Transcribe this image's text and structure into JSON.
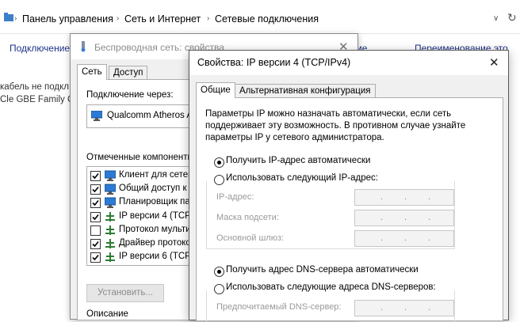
{
  "breadcrumb": {
    "items": [
      "Панель управления",
      "Сеть и Интернет",
      "Сетевые подключения"
    ]
  },
  "toolbar": {
    "left_label": "Подключение",
    "middle_label": "ие",
    "right_label": "Переименование это"
  },
  "explorer_side": {
    "line1": "кабель не подкл",
    "line2": "Cle GBE Family C"
  },
  "wireless_dialog": {
    "title": "Беспроводная сеть: свойства",
    "tabs": [
      "Сеть",
      "Доступ"
    ],
    "connect_via_label": "Подключение через:",
    "adapter_name": "Qualcomm Atheros A",
    "components_label": "Отмеченные компоненты",
    "components": [
      {
        "label": "Клиент для сетей",
        "checked": true,
        "icon": "network-client-icon"
      },
      {
        "label": "Общий доступ к ф",
        "checked": true,
        "icon": "file-sharing-icon"
      },
      {
        "label": "Планировщик па",
        "checked": true,
        "icon": "packet-scheduler-icon"
      },
      {
        "label": "IP версии 4 (TCP",
        "checked": true,
        "icon": "protocol-icon"
      },
      {
        "label": "Протокол мульти",
        "checked": false,
        "icon": "protocol-icon"
      },
      {
        "label": "Драйвер протоко",
        "checked": true,
        "icon": "protocol-icon"
      },
      {
        "label": "IP версии 6 (TCP",
        "checked": true,
        "icon": "protocol-icon"
      }
    ],
    "install_button": "Установить...",
    "description_label": "Описание"
  },
  "ipv4_dialog": {
    "title": "Свойства: IP версии 4 (TCP/IPv4)",
    "tabs": [
      "Общие",
      "Альтернативная конфигурация"
    ],
    "description": [
      "Параметры IP можно назначать автоматически, если сеть",
      "поддерживает эту возможность. В противном случае узнайте",
      "параметры IP у сетевого администратора."
    ],
    "ip_auto_label": "Получить IP-адрес автоматически",
    "ip_manual_label": "Использовать следующий IP-адрес:",
    "ip_mode": "auto",
    "ip_fields": [
      {
        "label": "IP-адрес:"
      },
      {
        "label": "Маска подсети:"
      },
      {
        "label": "Основной шлюз:"
      }
    ],
    "dns_auto_label": "Получить адрес DNS-сервера автоматически",
    "dns_manual_label": "Использовать следующие адреса DNS-серверов:",
    "dns_mode": "auto",
    "dns_fields": [
      {
        "label": "Предпочитаемый DNS-сервер:"
      }
    ]
  }
}
